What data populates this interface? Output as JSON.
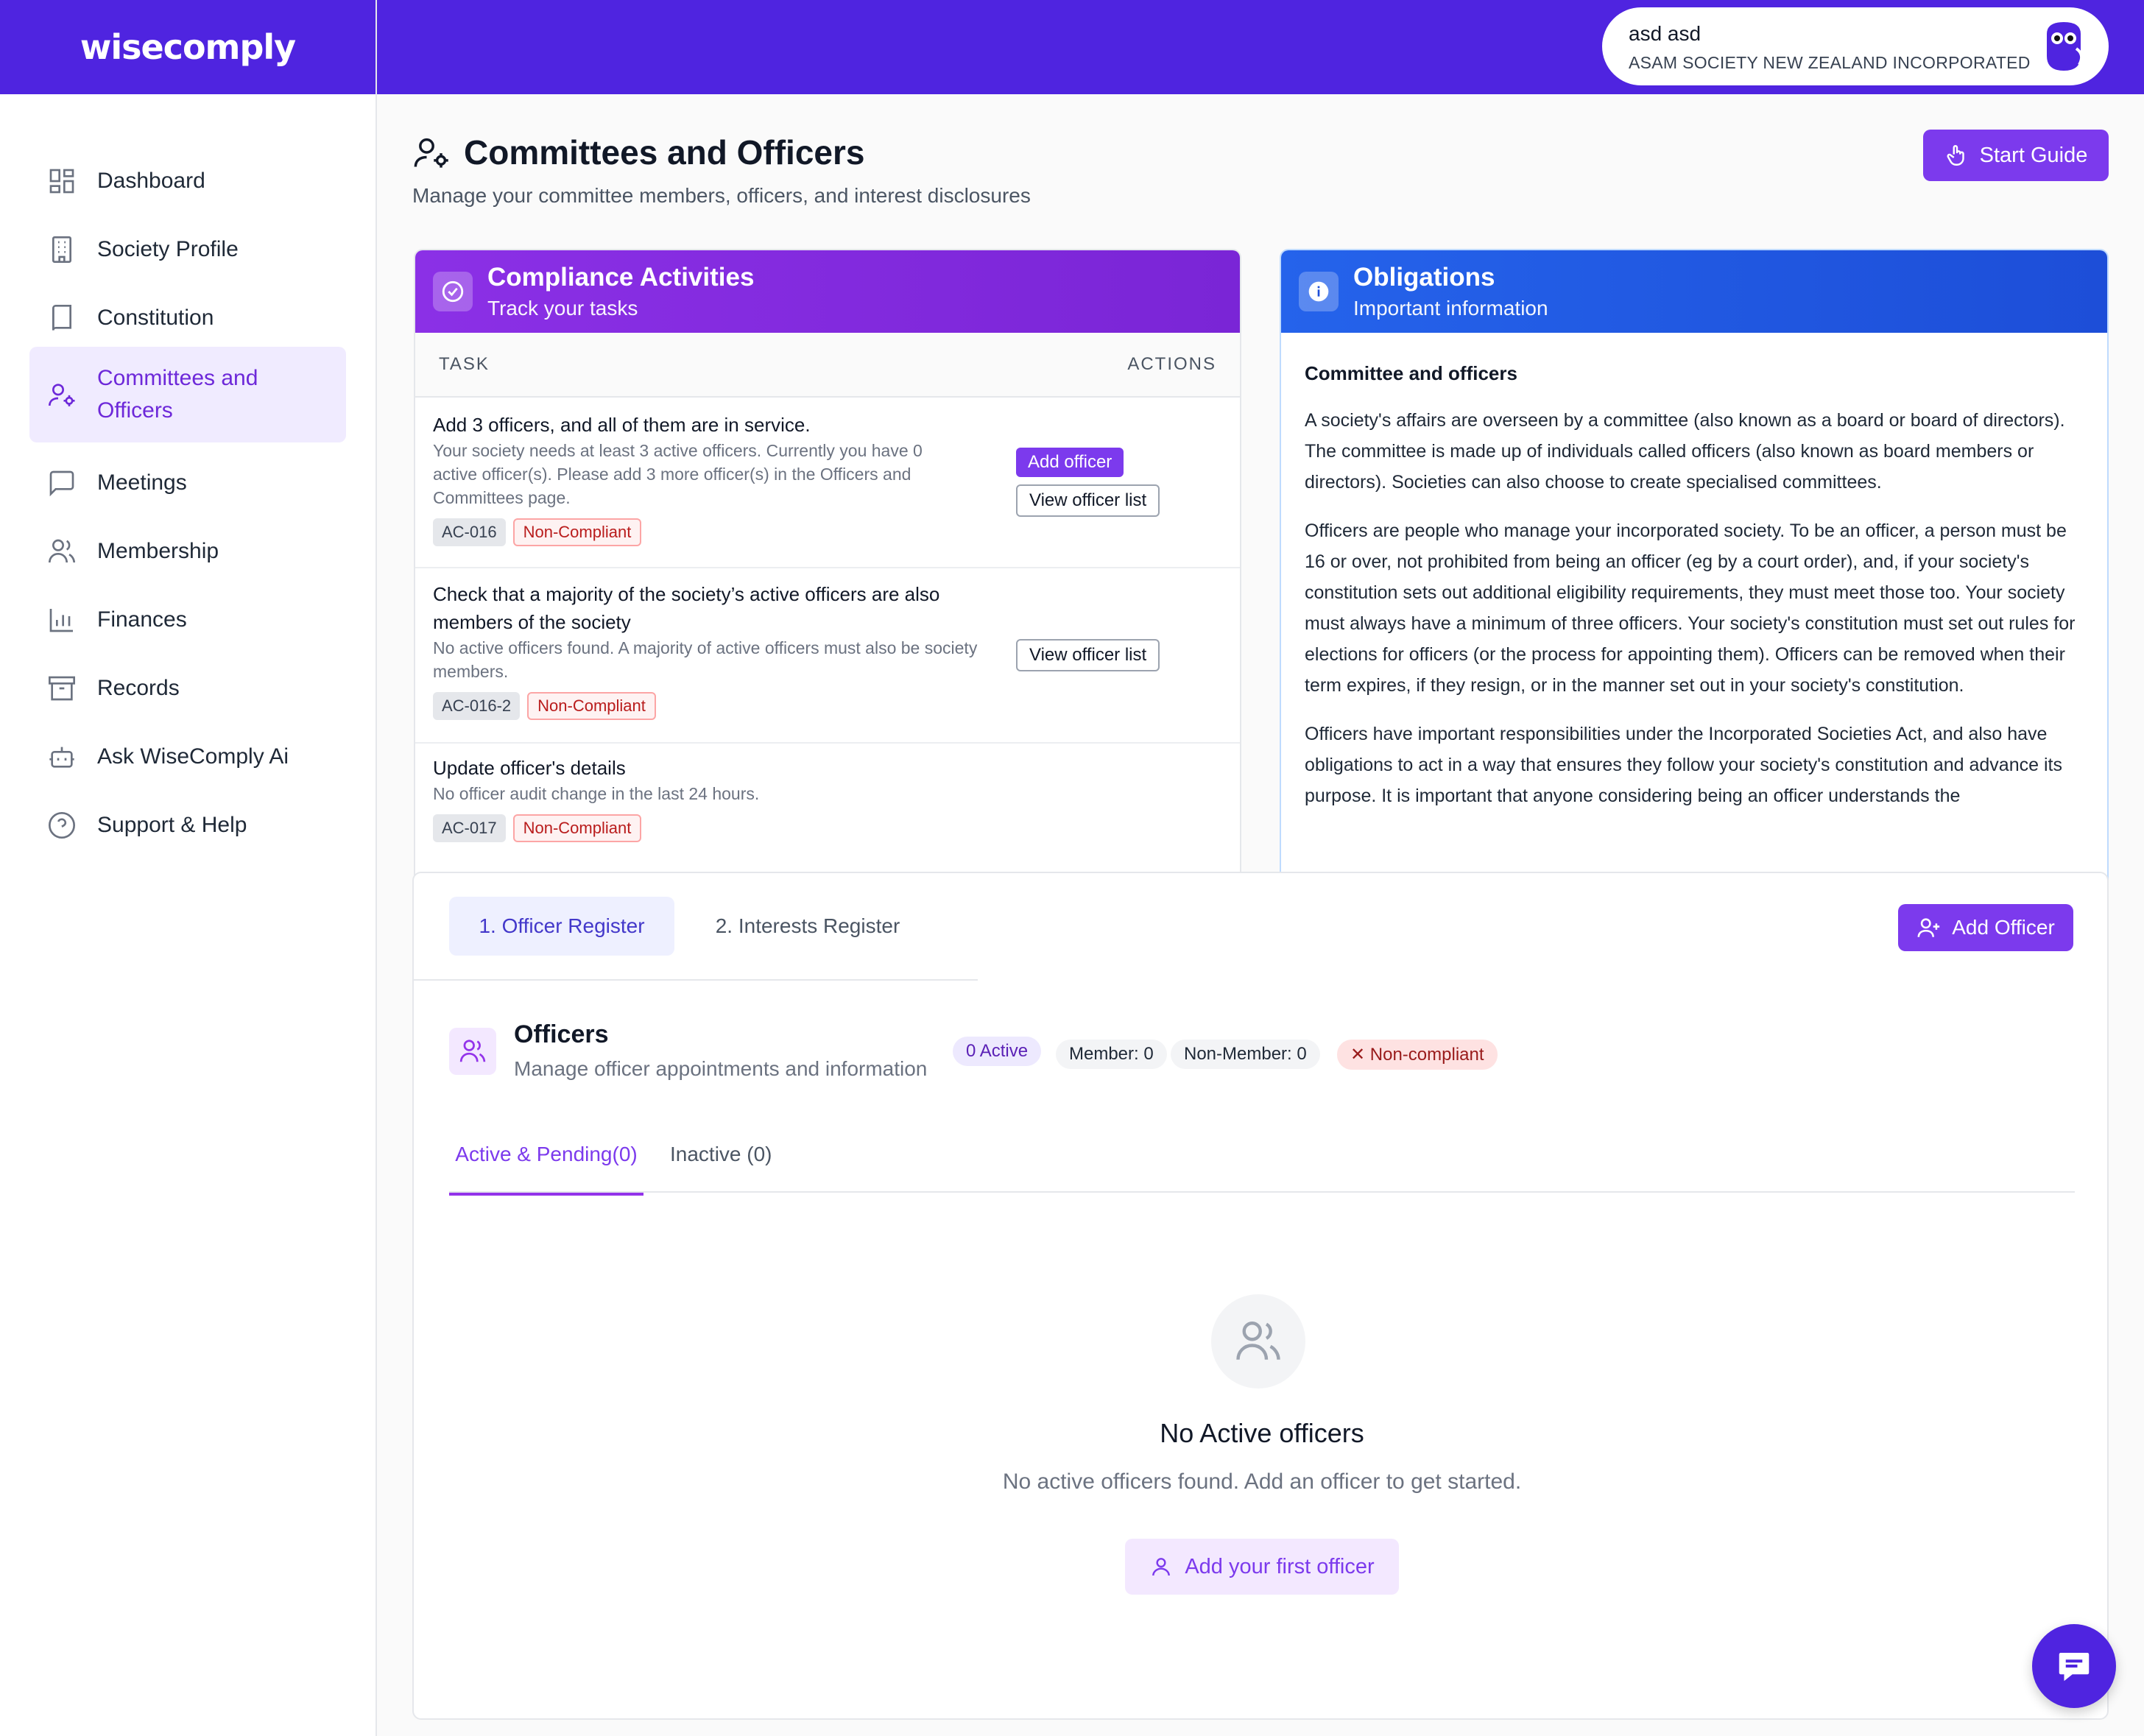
{
  "app": {
    "logo": "wisecomply"
  },
  "user": {
    "name": "asd asd",
    "org": "ASAM SOCIETY NEW ZEALAND INCORPORATED"
  },
  "sidebar": {
    "items": [
      {
        "label": "Dashboard",
        "icon": "dashboard-icon"
      },
      {
        "label": "Society Profile",
        "icon": "building-icon"
      },
      {
        "label": "Constitution",
        "icon": "book-icon"
      },
      {
        "label": "Committees and Officers",
        "icon": "user-gear-icon",
        "active": true
      },
      {
        "label": "Meetings",
        "icon": "message-icon"
      },
      {
        "label": "Membership",
        "icon": "users-icon"
      },
      {
        "label": "Finances",
        "icon": "bar-chart-icon"
      },
      {
        "label": "Records",
        "icon": "archive-icon"
      },
      {
        "label": "Ask WiseComply Ai",
        "icon": "bot-icon"
      },
      {
        "label": "Support & Help",
        "icon": "help-circle-icon"
      }
    ]
  },
  "page": {
    "title": "Committees and Officers",
    "subtitle": "Manage your committee members, officers, and interest disclosures",
    "start_guide": "Start Guide"
  },
  "compliance": {
    "title": "Compliance Activities",
    "subtitle": "Track your tasks",
    "col_task": "TASK",
    "col_actions": "ACTIONS",
    "tasks": [
      {
        "title": "Add 3 officers, and all of them are in service.",
        "desc": "Your society needs at least 3 active officers. Currently you have 0 active officer(s). Please add 3 more officer(s) in the Officers and Committees page.",
        "code": "AC-016",
        "status": "Non-Compliant",
        "action_primary": "Add officer",
        "action_secondary": "View officer list"
      },
      {
        "title": "Check that a majority of the society’s active officers are also members of the society",
        "desc": "No active officers found. A majority of active officers must also be society members.",
        "code": "AC-016-2",
        "status": "Non-Compliant",
        "action_secondary": "View officer list"
      },
      {
        "title": "Update officer's details",
        "desc": "No officer audit change in the last 24 hours.",
        "code": "AC-017",
        "status": "Non-Compliant"
      }
    ]
  },
  "obligations": {
    "title": "Obligations",
    "subtitle": "Important information",
    "heading": "Committee and officers",
    "paragraphs": [
      "A society's affairs are overseen by a committee (also known as a board or board of directors). The committee is made up of individuals called officers (also known as board members or directors). Societies can also choose to create specialised committees.",
      "Officers are people who manage your incorporated society. To be an officer, a person must be 16 or over, not prohibited from being an officer (eg by a court order), and, if your society's constitution sets out additional eligibility requirements, they must meet those too. Your society must always have a minimum of three officers. Your society's constitution must set out rules for elections for officers (or the process for appointing them). Officers can be removed when their term expires, if they resign, or in the manner set out in your society's constitution.",
      "Officers have important responsibilities under the Incorporated Societies Act, and also have obligations to act in a way that ensures they follow your society's constitution and advance its purpose. It is important that anyone considering being an officer understands the"
    ]
  },
  "register": {
    "tab1": "1. Officer Register",
    "tab2": "2. Interests Register",
    "add_officer": "Add Officer",
    "officers_title": "Officers",
    "officers_sub": "Manage officer appointments and information",
    "badge_active": "0 Active",
    "badge_member": "Member: 0",
    "badge_nonmember": "Non-Member: 0",
    "badge_noncompliant": "✕ Non-compliant",
    "subtab_active": "Active & Pending(0)",
    "subtab_inactive": "Inactive (0)",
    "empty_title": "No Active officers",
    "empty_desc": "No active officers found. Add an officer to get started.",
    "empty_button": "Add your first officer"
  },
  "colors": {
    "brand": "#4f24e0",
    "accent": "#7c3aed",
    "blue": "#1d4ed8",
    "danger": "#b91c1c"
  }
}
